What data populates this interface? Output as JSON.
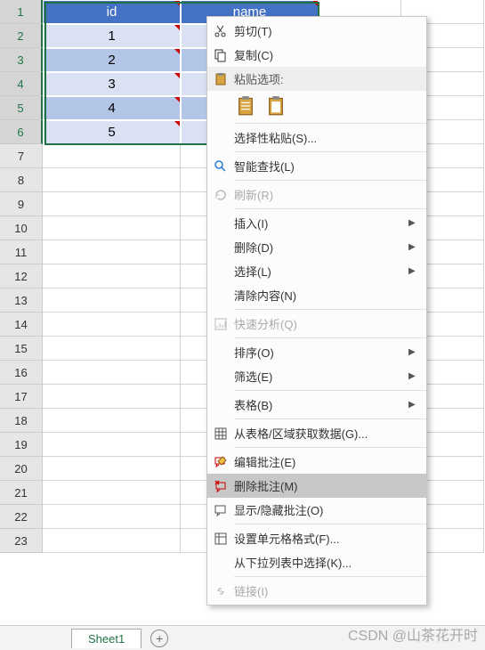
{
  "headers": {
    "col1": "id",
    "col2": "name"
  },
  "data_rows": [
    "1",
    "2",
    "3",
    "4",
    "5"
  ],
  "row_numbers": [
    "1",
    "2",
    "3",
    "4",
    "5",
    "6",
    "7",
    "8",
    "9",
    "10",
    "11",
    "12",
    "13",
    "14",
    "15",
    "16",
    "17",
    "18",
    "19",
    "20",
    "21",
    "22",
    "23"
  ],
  "tabs": {
    "sheet1": "Sheet1"
  },
  "watermark": "CSDN @山茶花开时",
  "menu": {
    "cut": "剪切(T)",
    "copy": "复制(C)",
    "paste_options": "粘贴选项:",
    "paste_special": "选择性粘贴(S)...",
    "smart_lookup": "智能查找(L)",
    "refresh": "刷新(R)",
    "insert": "插入(I)",
    "delete": "删除(D)",
    "select": "选择(L)",
    "clear": "清除内容(N)",
    "quick_analysis": "快速分析(Q)",
    "sort": "排序(O)",
    "filter": "筛选(E)",
    "table": "表格(B)",
    "get_data": "从表格/区域获取数据(G)...",
    "edit_comment": "编辑批注(E)",
    "delete_comment": "删除批注(M)",
    "show_hide_comment": "显示/隐藏批注(O)",
    "format_cells": "设置单元格格式(F)...",
    "dropdown_pick": "从下拉列表中选择(K)...",
    "link": "链接(I)"
  }
}
